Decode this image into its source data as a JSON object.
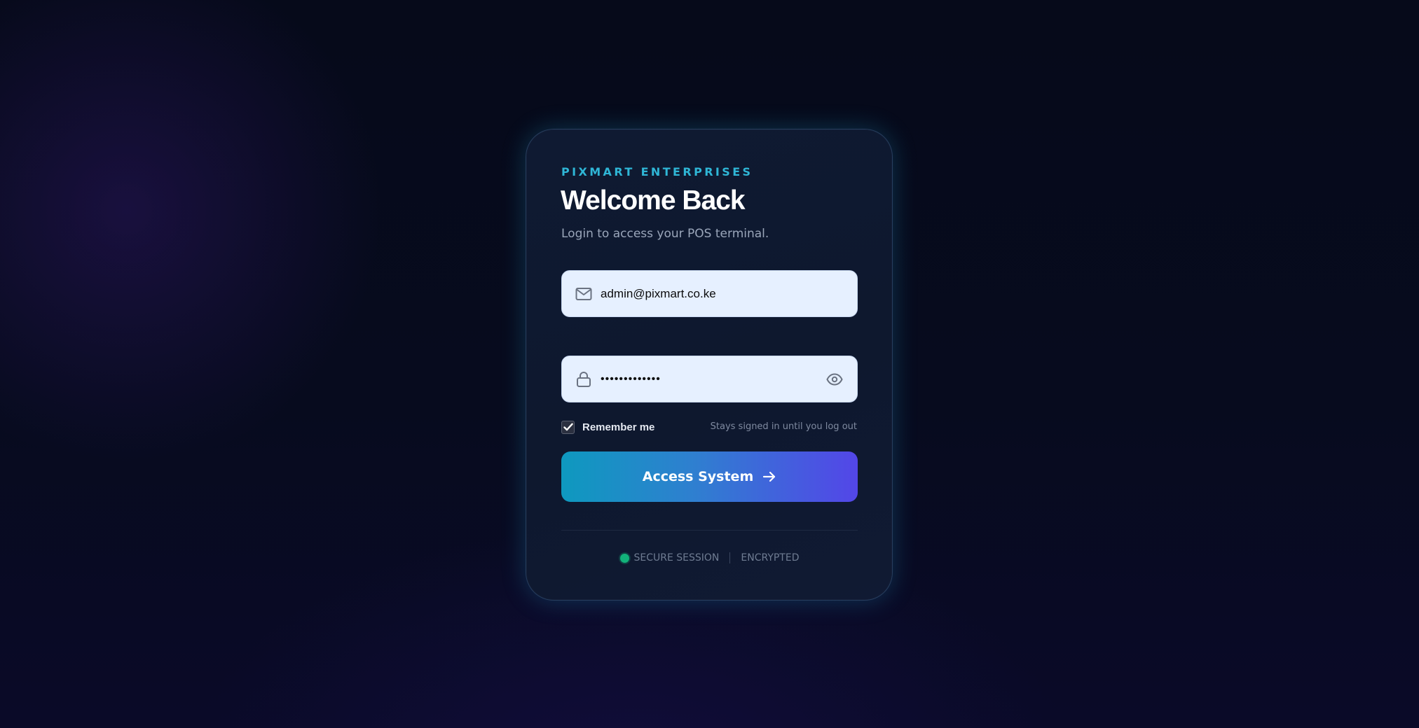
{
  "brand": "PIXMART ENTERPRISES",
  "title": "Welcome Back",
  "subtitle": "Login to access your POS terminal.",
  "email_field": {
    "value": "admin@pixmart.co.ke",
    "icon": "mail-icon"
  },
  "password_field": {
    "value": "•••••••••••••",
    "icon": "lock-icon",
    "toggle_icon": "eye-icon"
  },
  "remember": {
    "label": "Remember me",
    "checked": true,
    "hint": "Stays signed in until you log out"
  },
  "submit": {
    "label": "Access System",
    "icon": "arrow-right-icon"
  },
  "status": {
    "secure": "SECURE SESSION",
    "encrypted": "ENCRYPTED"
  },
  "colors": {
    "accent": "#2fb6d6",
    "button_start": "#0e99bf",
    "button_end": "#5346e8",
    "secure_dot": "#12b27a"
  }
}
